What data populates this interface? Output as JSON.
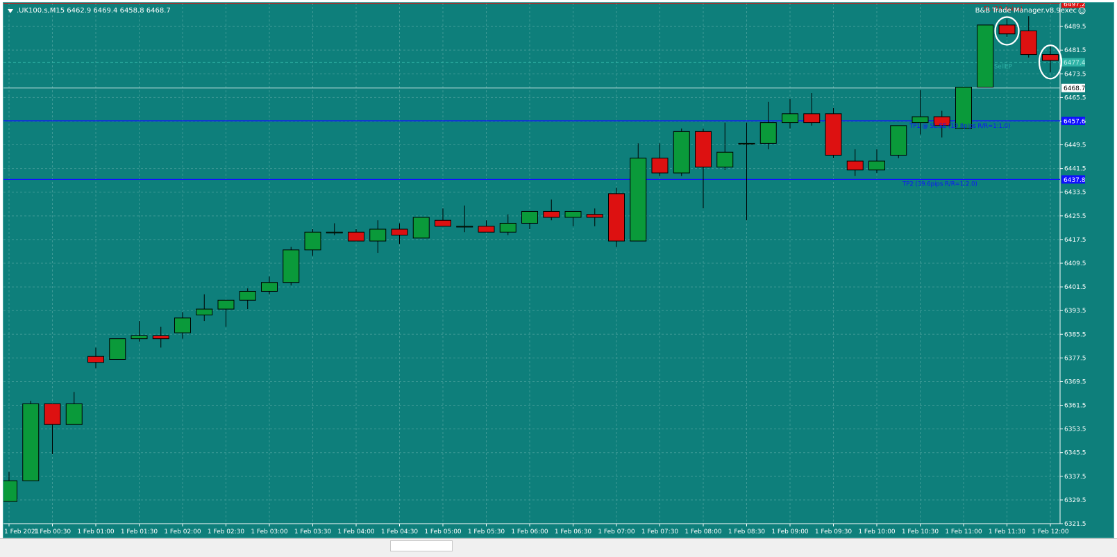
{
  "header": {
    "symbol_ohlc": ".UK100.s,M15  6462.9 6469.4 6458.8 6468.7",
    "ea_title": "B&B Trade Manager.v8.9exec",
    "ea_icon": "smiley-icon"
  },
  "colors": {
    "background": "#0e7f7b",
    "grid": "#3f9a96",
    "bull": "#0a9a3a",
    "bear": "#dd1111",
    "sl_line": "#dd1111",
    "tp_line": "#1010ff",
    "axis_text": "#ffffff",
    "annotation": "#ffffff"
  },
  "chart_data": {
    "type": "candlestick",
    "ylim": [
      6321.5,
      6497.5
    ],
    "y_ticks": [
      "6321.5",
      "6329.5",
      "6337.5",
      "6345.5",
      "6353.5",
      "6361.5",
      "6369.5",
      "6377.5",
      "6385.5",
      "6393.5",
      "6401.5",
      "6409.5",
      "6417.5",
      "6425.5",
      "6433.5",
      "6441.5",
      "6449.5",
      "6457.5",
      "6465.5",
      "6473.5",
      "6481.5",
      "6489.5"
    ],
    "x_labels": [
      "1 Feb 2021",
      "1 Feb 00:30",
      "1 Feb 01:00",
      "1 Feb 01:30",
      "1 Feb 02:00",
      "1 Feb 02:30",
      "1 Feb 03:00",
      "1 Feb 03:30",
      "1 Feb 04:00",
      "1 Feb 04:30",
      "1 Feb 05:00",
      "1 Feb 05:30",
      "1 Feb 06:00",
      "1 Feb 06:30",
      "1 Feb 07:00",
      "1 Feb 07:30",
      "1 Feb 08:00",
      "1 Feb 08:30",
      "1 Feb 09:00",
      "1 Feb 09:30",
      "1 Feb 10:00",
      "1 Feb 10:30",
      "1 Feb 11:00",
      "1 Feb 11:30",
      "1 Feb 12:00"
    ],
    "candles": [
      {
        "o": 6329,
        "h": 6339,
        "l": 6329,
        "c": 6336
      },
      {
        "o": 6336,
        "h": 6363,
        "l": 6336,
        "c": 6362
      },
      {
        "o": 6362,
        "h": 6362,
        "l": 6345,
        "c": 6355
      },
      {
        "o": 6355,
        "h": 6366,
        "l": 6355,
        "c": 6362
      },
      {
        "o": 6378,
        "h": 6381,
        "l": 6374,
        "c": 6376
      },
      {
        "o": 6377,
        "h": 6384,
        "l": 6377,
        "c": 6384
      },
      {
        "o": 6384,
        "h": 6390,
        "l": 6383,
        "c": 6385
      },
      {
        "o": 6385,
        "h": 6388,
        "l": 6381,
        "c": 6384
      },
      {
        "o": 6386,
        "h": 6393,
        "l": 6384,
        "c": 6391
      },
      {
        "o": 6392,
        "h": 6399,
        "l": 6390,
        "c": 6394
      },
      {
        "o": 6394,
        "h": 6397,
        "l": 6388,
        "c": 6397
      },
      {
        "o": 6397,
        "h": 6401,
        "l": 6394,
        "c": 6400
      },
      {
        "o": 6400,
        "h": 6405,
        "l": 6399,
        "c": 6403
      },
      {
        "o": 6403,
        "h": 6415,
        "l": 6402,
        "c": 6414
      },
      {
        "o": 6414,
        "h": 6421,
        "l": 6412,
        "c": 6420
      },
      {
        "o": 6420,
        "h": 6423,
        "l": 6419,
        "c": 6420
      },
      {
        "o": 6420,
        "h": 6421,
        "l": 6417,
        "c": 6417
      },
      {
        "o": 6417,
        "h": 6424,
        "l": 6413,
        "c": 6421
      },
      {
        "o": 6421,
        "h": 6423,
        "l": 6416,
        "c": 6419
      },
      {
        "o": 6418,
        "h": 6425,
        "l": 6418,
        "c": 6425
      },
      {
        "o": 6424,
        "h": 6428,
        "l": 6422,
        "c": 6422
      },
      {
        "o": 6422,
        "h": 6429,
        "l": 6420,
        "c": 6422
      },
      {
        "o": 6422,
        "h": 6424,
        "l": 6420,
        "c": 6420
      },
      {
        "o": 6420,
        "h": 6426,
        "l": 6419,
        "c": 6423
      },
      {
        "o": 6423,
        "h": 6427,
        "l": 6421,
        "c": 6427
      },
      {
        "o": 6427,
        "h": 6431,
        "l": 6424,
        "c": 6425
      },
      {
        "o": 6425,
        "h": 6427,
        "l": 6422,
        "c": 6427
      },
      {
        "o": 6426,
        "h": 6428,
        "l": 6422,
        "c": 6425
      },
      {
        "o": 6433,
        "h": 6435,
        "l": 6415,
        "c": 6417
      },
      {
        "o": 6417,
        "h": 6450,
        "l": 6417,
        "c": 6445
      },
      {
        "o": 6445,
        "h": 6450,
        "l": 6439,
        "c": 6440
      },
      {
        "o": 6440,
        "h": 6455,
        "l": 6439,
        "c": 6454
      },
      {
        "o": 6454,
        "h": 6455,
        "l": 6428,
        "c": 6442
      },
      {
        "o": 6442,
        "h": 6457,
        "l": 6441,
        "c": 6447
      },
      {
        "o": 6450,
        "h": 6457,
        "l": 6424,
        "c": 6450
      },
      {
        "o": 6450,
        "h": 6464,
        "l": 6448,
        "c": 6457
      },
      {
        "o": 6457,
        "h": 6465,
        "l": 6455,
        "c": 6460
      },
      {
        "o": 6460,
        "h": 6467,
        "l": 6456,
        "c": 6457
      },
      {
        "o": 6460,
        "h": 6462,
        "l": 6445,
        "c": 6446
      },
      {
        "o": 6444,
        "h": 6448,
        "l": 6439,
        "c": 6441
      },
      {
        "o": 6441,
        "h": 6448,
        "l": 6440,
        "c": 6444
      },
      {
        "o": 6446,
        "h": 6456,
        "l": 6445,
        "c": 6456
      },
      {
        "o": 6457,
        "h": 6468,
        "l": 6453,
        "c": 6459
      },
      {
        "o": 6459,
        "h": 6461,
        "l": 6452,
        "c": 6456
      },
      {
        "o": 6455,
        "h": 6469,
        "l": 6455,
        "c": 6469
      },
      {
        "o": 6469,
        "h": 6490,
        "l": 6469,
        "c": 6490
      },
      {
        "o": 6490,
        "h": 6492,
        "l": 6486,
        "c": 6487
      },
      {
        "o": 6488,
        "h": 6493,
        "l": 6479,
        "c": 6480
      },
      {
        "o": 6480,
        "h": 6483,
        "l": 6474,
        "c": 6478
      }
    ],
    "levels": [
      {
        "key": "sl",
        "price": 6497.2,
        "label": "6497.2",
        "text": "SL (19.4pips)",
        "color": "#dd1111"
      },
      {
        "key": "entry",
        "price": 6477.4,
        "label": "6477.4",
        "text": "SellEP",
        "color": "#2fb3a6"
      },
      {
        "key": "current",
        "price": 6468.7,
        "label": "6468.7",
        "text": "",
        "color": "#c9e6e4"
      },
      {
        "key": "tp1",
        "price": 6457.6,
        "label": "6457.6",
        "text": "TP1 @ SL.SE (19.8pips R/R=1:1.0)",
        "color": "#1010ff"
      },
      {
        "key": "tp2",
        "price": 6437.8,
        "label": "6437.8",
        "text": "TP2 (39.6pips R/R=1:2.0)",
        "color": "#1010ff"
      }
    ]
  }
}
